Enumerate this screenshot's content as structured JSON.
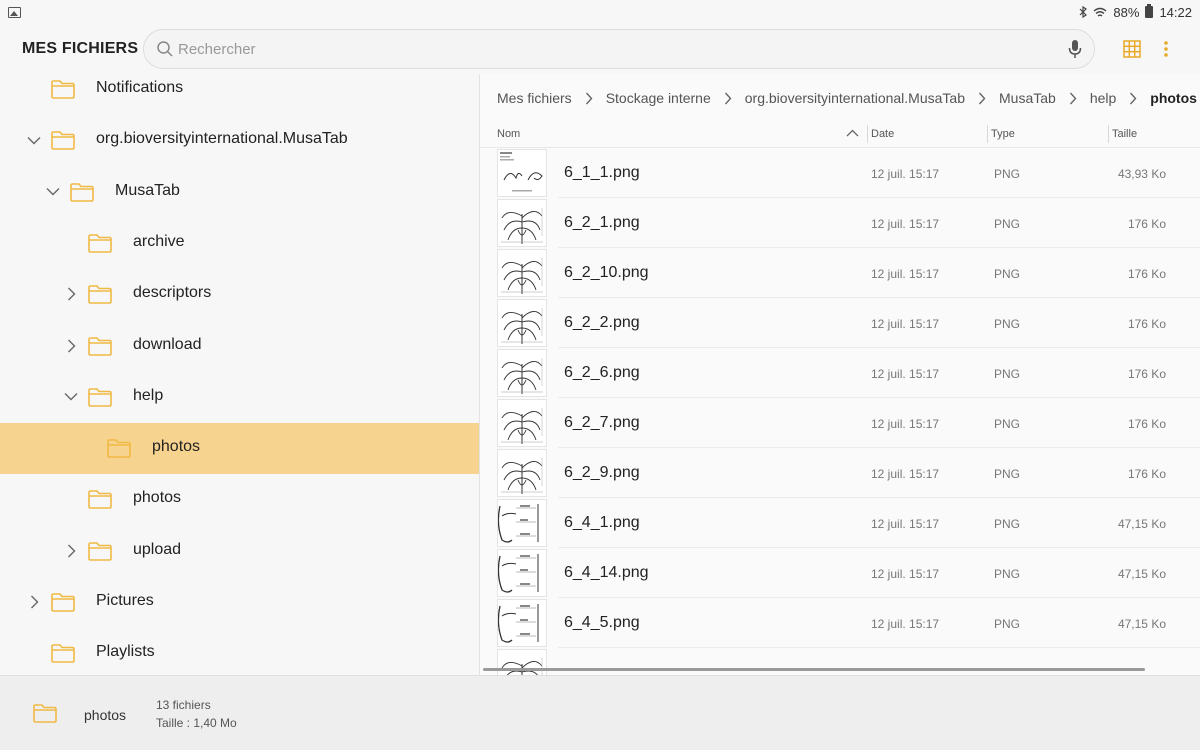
{
  "status_bar": {
    "battery": "88%",
    "time": "14:22"
  },
  "app": {
    "title": "MES FICHIERS"
  },
  "search": {
    "placeholder": "Rechercher"
  },
  "tree": [
    {
      "label": "Notifications",
      "level": 1,
      "expander": "none"
    },
    {
      "label": "org.bioversityinternational.MusaTab",
      "level": 1,
      "expander": "expanded"
    },
    {
      "label": "MusaTab",
      "level": 2,
      "expander": "expanded"
    },
    {
      "label": "archive",
      "level": 3,
      "expander": "none"
    },
    {
      "label": "descriptors",
      "level": 3,
      "expander": "collapsed"
    },
    {
      "label": "download",
      "level": 3,
      "expander": "collapsed"
    },
    {
      "label": "help",
      "level": 3,
      "expander": "expanded"
    },
    {
      "label": "photos",
      "level": 4,
      "expander": "none",
      "selected": true
    },
    {
      "label": "photos",
      "level": 3,
      "expander": "none"
    },
    {
      "label": "upload",
      "level": 3,
      "expander": "collapsed"
    },
    {
      "label": "Pictures",
      "level": 1,
      "expander": "collapsed"
    },
    {
      "label": "Playlists",
      "level": 1,
      "expander": "none"
    }
  ],
  "breadcrumb": [
    "Mes fichiers",
    "Stockage interne",
    "org.bioversityinternational.MusaTab",
    "MusaTab",
    "help",
    "photos"
  ],
  "columns": {
    "name": "Nom",
    "date": "Date",
    "type": "Type",
    "size": "Taille"
  },
  "files": [
    {
      "name": "6_1_1.png",
      "date": "12 juil. 15:17",
      "type": "PNG",
      "size": "43,93 Ko",
      "thumb": "sketch-a"
    },
    {
      "name": "6_2_1.png",
      "date": "12 juil. 15:17",
      "type": "PNG",
      "size": "176 Ko",
      "thumb": "plant"
    },
    {
      "name": "6_2_10.png",
      "date": "12 juil. 15:17",
      "type": "PNG",
      "size": "176 Ko",
      "thumb": "plant"
    },
    {
      "name": "6_2_2.png",
      "date": "12 juil. 15:17",
      "type": "PNG",
      "size": "176 Ko",
      "thumb": "plant"
    },
    {
      "name": "6_2_6.png",
      "date": "12 juil. 15:17",
      "type": "PNG",
      "size": "176 Ko",
      "thumb": "plant"
    },
    {
      "name": "6_2_7.png",
      "date": "12 juil. 15:17",
      "type": "PNG",
      "size": "176 Ko",
      "thumb": "plant"
    },
    {
      "name": "6_2_9.png",
      "date": "12 juil. 15:17",
      "type": "PNG",
      "size": "176 Ko",
      "thumb": "plant"
    },
    {
      "name": "6_4_1.png",
      "date": "12 juil. 15:17",
      "type": "PNG",
      "size": "47,15 Ko",
      "thumb": "diagram"
    },
    {
      "name": "6_4_14.png",
      "date": "12 juil. 15:17",
      "type": "PNG",
      "size": "47,15 Ko",
      "thumb": "diagram"
    },
    {
      "name": "6_4_5.png",
      "date": "12 juil. 15:17",
      "type": "PNG",
      "size": "47,15 Ko",
      "thumb": "diagram"
    }
  ],
  "footer": {
    "folder_name": "photos",
    "file_count": "13 fichiers",
    "size": "Taille : 1,40 Mo"
  },
  "colors": {
    "accent": "#e9a928",
    "folder": "#f0b944",
    "selected_row": "#f6d48f"
  }
}
